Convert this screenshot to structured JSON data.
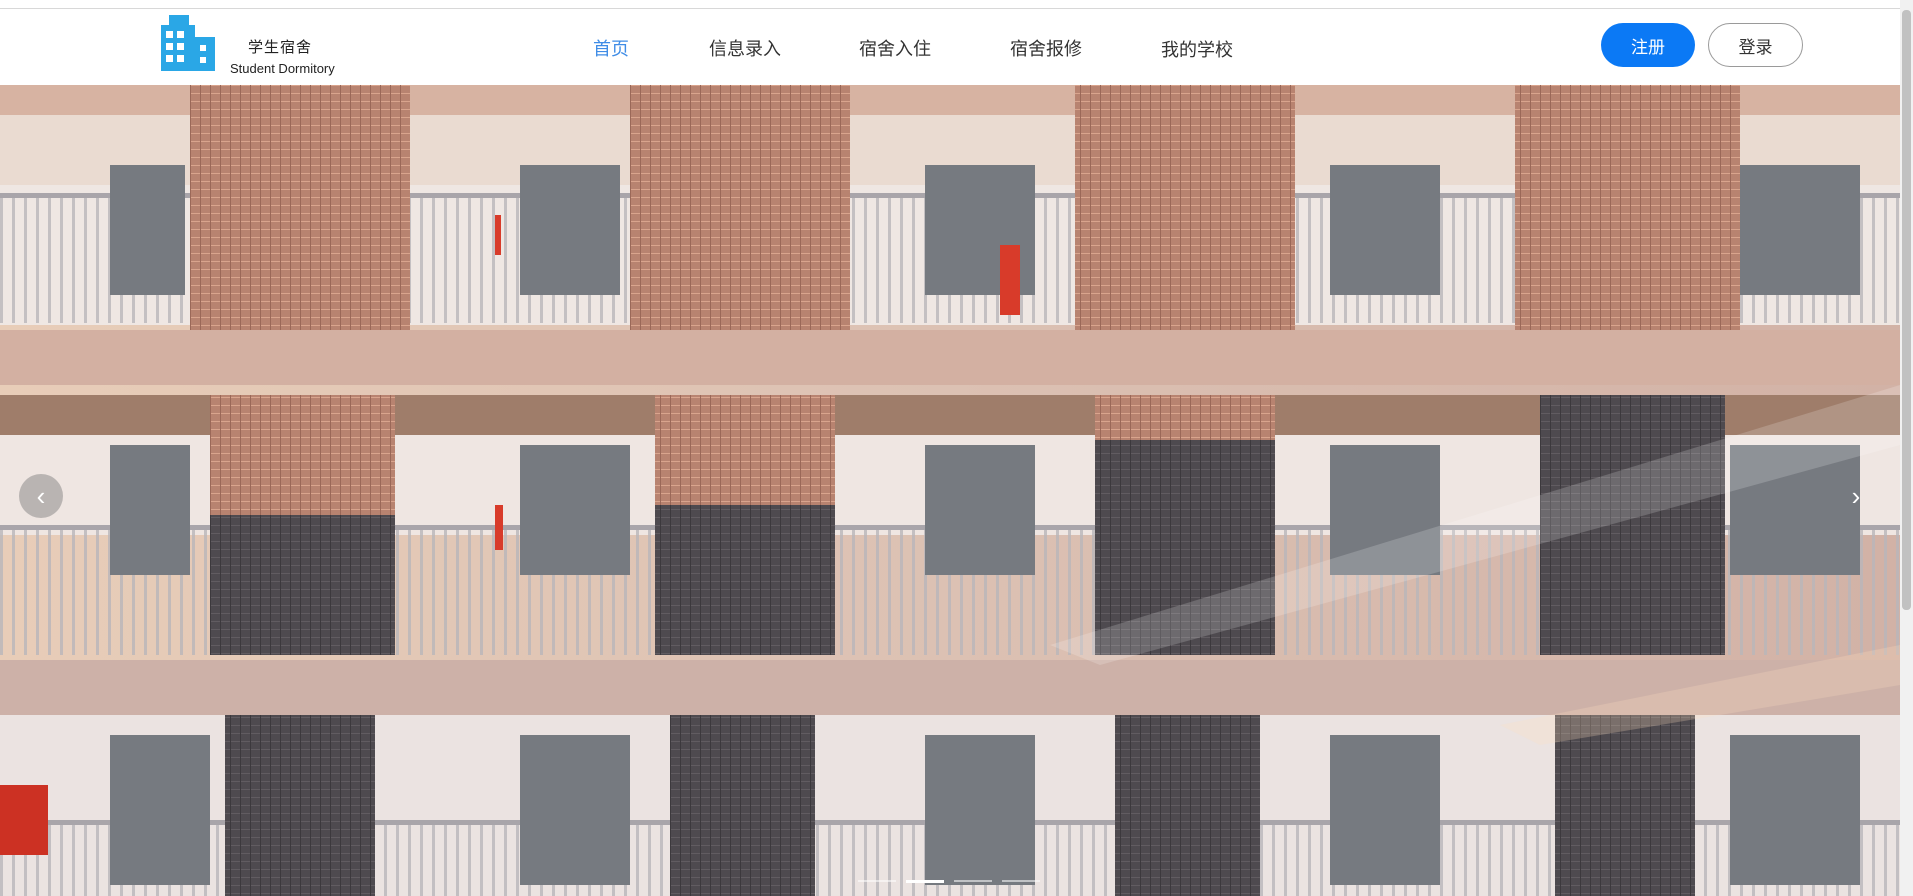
{
  "header": {
    "logo_title": "学生宿舍",
    "logo_subtitle": "Student Dormitory",
    "logo_icon": "building-icon",
    "nav": [
      {
        "label": "首页",
        "active": true
      },
      {
        "label": "信息录入",
        "active": false
      },
      {
        "label": "宿舍入住",
        "active": false
      },
      {
        "label": "宿舍报修",
        "active": false
      },
      {
        "label": "我的学校",
        "active": false
      }
    ],
    "register_label": "注册",
    "login_label": "登录"
  },
  "carousel": {
    "image": "dormitory-building-photo",
    "prev_icon": "chevron-left-icon",
    "next_icon": "chevron-right-icon",
    "prev_glyph": "‹",
    "next_glyph": "›",
    "slide_count": 4,
    "active_slide": 2
  },
  "colors": {
    "accent": "#3f8ce6",
    "register_bg": "#0b79f5",
    "logo_blue": "#2aa7e6"
  }
}
